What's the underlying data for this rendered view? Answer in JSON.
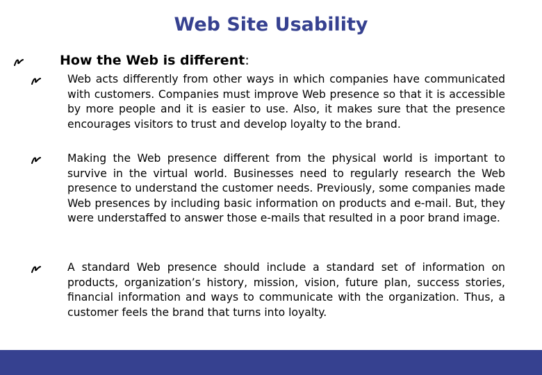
{
  "title": "Web Site Usability",
  "colors": {
    "title": "#364190",
    "footer_band": "#364190",
    "text": "#000000"
  },
  "heading": {
    "label": "How the Web is different",
    "suffix": ":",
    "bullet_icon": "scribble-bullet-icon"
  },
  "points": [
    {
      "bullet_icon": "scribble-bullet-icon",
      "text": "Web acts differently from other ways in which companies have communicated with customers. Companies must improve Web presence so that it is accessible by more people and it is easier to use. Also, it makes sure that the presence encourages visitors to trust and develop loyalty to the brand."
    },
    {
      "bullet_icon": "scribble-bullet-icon",
      "text": "Making the Web presence different from the physical world is important to survive in the virtual world. Businesses need to regularly research the Web presence to understand the customer needs. Previously, some companies made Web presences by including basic information on products and e-mail. But, they were understaffed to answer those e-mails that resulted in a poor brand image."
    },
    {
      "bullet_icon": "scribble-bullet-icon",
      "text": "A standard Web presence should include a standard set of information on products, organization’s history, mission, vision, future plan, success stories, financial information and ways to communicate with the organization. Thus, a customer feels the brand that turns into loyalty."
    }
  ]
}
